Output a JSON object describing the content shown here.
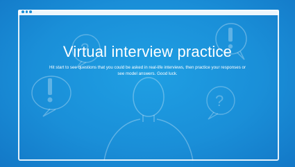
{
  "window": {
    "dots": [
      "window-dot",
      "window-dot",
      "window-dot"
    ]
  },
  "hero": {
    "title": "Virtual interview practice",
    "subtitle": "Hit start to see questions that you could be asked in real-life interviews, then practice your responses or see model answers. Good luck."
  },
  "icons": [
    "question-mark-bubble-icon",
    "exclamation-mark-bubble-icon",
    "person-silhouette-icon"
  ],
  "colors": {
    "background": "#1a8fd8",
    "chalk": "#ffffff"
  }
}
